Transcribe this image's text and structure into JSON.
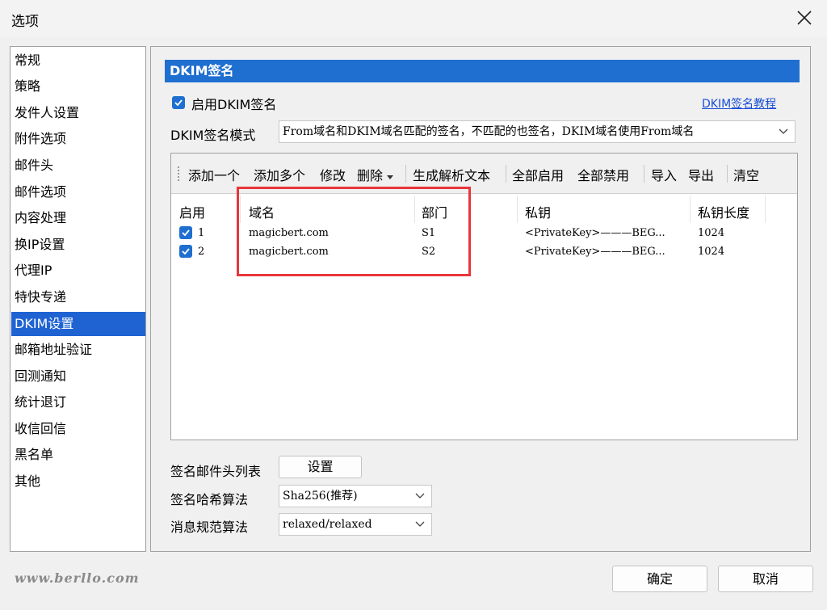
{
  "window": {
    "title": "选项"
  },
  "nav": {
    "items": [
      "常规",
      "策略",
      "发件人设置",
      "附件选项",
      "邮件头",
      "邮件选项",
      "内容处理",
      "换IP设置",
      "代理IP",
      "特快专递",
      "DKIM设置",
      "邮箱地址验证",
      "回测通知",
      "统计退订",
      "收信回信",
      "黑名单",
      "其他"
    ],
    "selected": "DKIM设置"
  },
  "dkim": {
    "section_title": "DKIM签名",
    "enable_label": "启用DKIM签名",
    "enable_checked": true,
    "tutorial_link": "DKIM签名教程",
    "mode_label": "DKIM签名模式",
    "mode_value": "From域名和DKIM域名匹配的签名，不匹配的也签名，DKIM域名使用From域名",
    "toolbar": {
      "add_one": "添加一个",
      "add_many": "添加多个",
      "edit": "修改",
      "delete": "删除",
      "generate": "生成解析文本",
      "enable_all": "全部启用",
      "disable_all": "全部禁用",
      "import": "导入",
      "export": "导出",
      "clear": "清空"
    },
    "table": {
      "columns": [
        "启用",
        "域名",
        "部门",
        "私钥",
        "私钥长度"
      ],
      "rows": [
        {
          "enabled": true,
          "index": "1",
          "domain": "magicbert.com",
          "dept": "S1",
          "key": "<PrivateKey>———BEG...",
          "length": "1024"
        },
        {
          "enabled": true,
          "index": "2",
          "domain": "magicbert.com",
          "dept": "S2",
          "key": "<PrivateKey>———BEG...",
          "length": "1024"
        }
      ]
    },
    "header_list_label": "签名邮件头列表",
    "header_list_button": "设置",
    "hash_label": "签名哈希算法",
    "hash_value": "Sha256(推荐)",
    "canon_label": "消息规范算法",
    "canon_value": "relaxed/relaxed"
  },
  "footer": {
    "watermark": "www.berllo.com",
    "ok": "确定",
    "cancel": "取消"
  },
  "colors": {
    "accent": "#1f6fd0",
    "highlight": "#e8363a"
  }
}
